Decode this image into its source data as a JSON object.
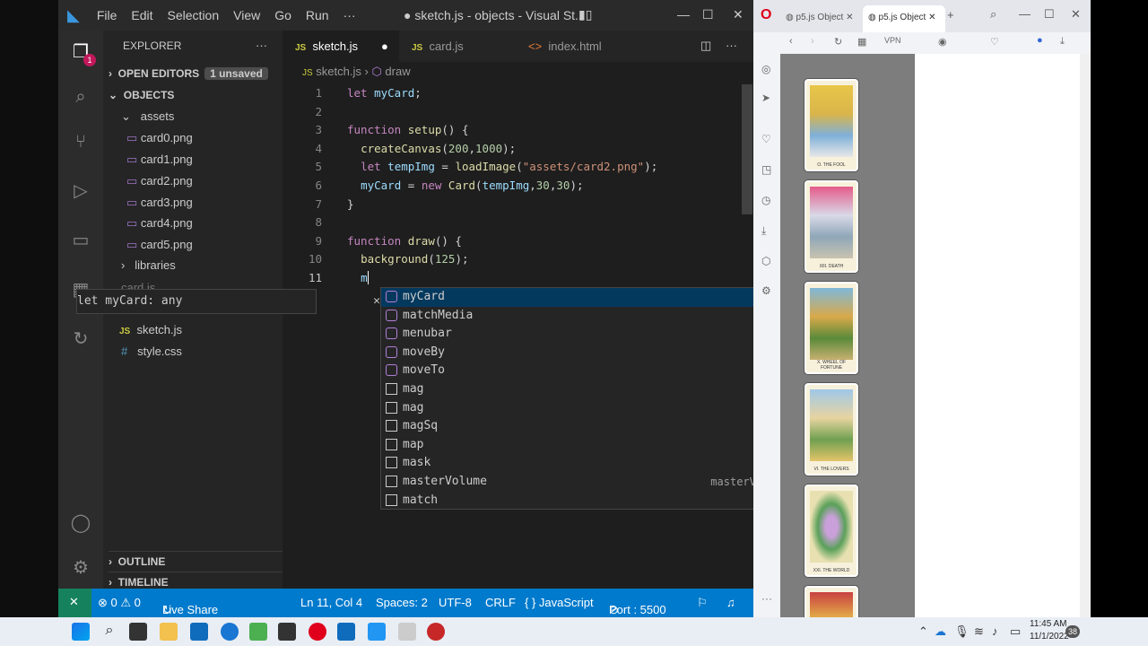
{
  "window_title": "● sketch.js - objects - Visual St...",
  "menu": [
    "File",
    "Edit",
    "Selection",
    "View",
    "Go",
    "Run",
    "···"
  ],
  "activity_badge": "1",
  "explorer": {
    "title": "EXPLORER",
    "open_editors": "OPEN EDITORS",
    "unsaved_badge": "1 unsaved",
    "folder": "OBJECTS",
    "assets": "assets",
    "files": [
      "card0.png",
      "card1.png",
      "card2.png",
      "card3.png",
      "card4.png",
      "card5.png"
    ],
    "libraries": "libraries",
    "cardjs": "card.js",
    "sketchjs": "sketch.js",
    "stylecss": "style.css",
    "outline": "OUTLINE",
    "timeline": "TIMELINE"
  },
  "tabs": [
    {
      "label": "sketch.js",
      "active": true
    },
    {
      "label": "card.js",
      "active": false
    },
    {
      "label": "index.html",
      "active": false
    }
  ],
  "breadcrumb": {
    "file": "sketch.js",
    "symbol": "draw"
  },
  "hover_text": "let myCard: any",
  "suggestions": [
    {
      "label": "myCard",
      "detail": "",
      "kind": "var"
    },
    {
      "label": "matchMedia",
      "detail": "",
      "kind": "obj"
    },
    {
      "label": "menubar",
      "detail": "",
      "kind": "var"
    },
    {
      "label": "moveBy",
      "detail": "",
      "kind": "obj"
    },
    {
      "label": "moveTo",
      "detail": "",
      "kind": "obj"
    },
    {
      "label": "mag",
      "detail": "mag",
      "kind": "text"
    },
    {
      "label": "mag",
      "detail": "mag",
      "kind": "text"
    },
    {
      "label": "magSq",
      "detail": "magSq",
      "kind": "text"
    },
    {
      "label": "map",
      "detail": "map",
      "kind": "text"
    },
    {
      "label": "mask",
      "detail": "mask",
      "kind": "text"
    },
    {
      "label": "masterVolume",
      "detail": "masterVolume",
      "kind": "text"
    },
    {
      "label": "match",
      "detail": "match",
      "kind": "text"
    }
  ],
  "status": {
    "errors": "⊗ 0 ⚠ 0",
    "live_share": "Live Share",
    "position": "Ln 11, Col 4",
    "spaces": "Spaces: 2",
    "encoding": "UTF-8",
    "eol": "CRLF",
    "language": "{ } JavaScript",
    "port": "Port : 5500"
  },
  "browser": {
    "tab1": "p5.js Object",
    "tab2": "p5.js Object",
    "cards": [
      "O. THE FOOL",
      "XIII. DEATH",
      "X. WHEEL OF FORTUNE",
      "VI. THE LOVERS",
      "XXI. THE WORLD"
    ]
  },
  "taskbar": {
    "time": "11:45 AM",
    "date": "11/1/2022",
    "notif": "38"
  }
}
